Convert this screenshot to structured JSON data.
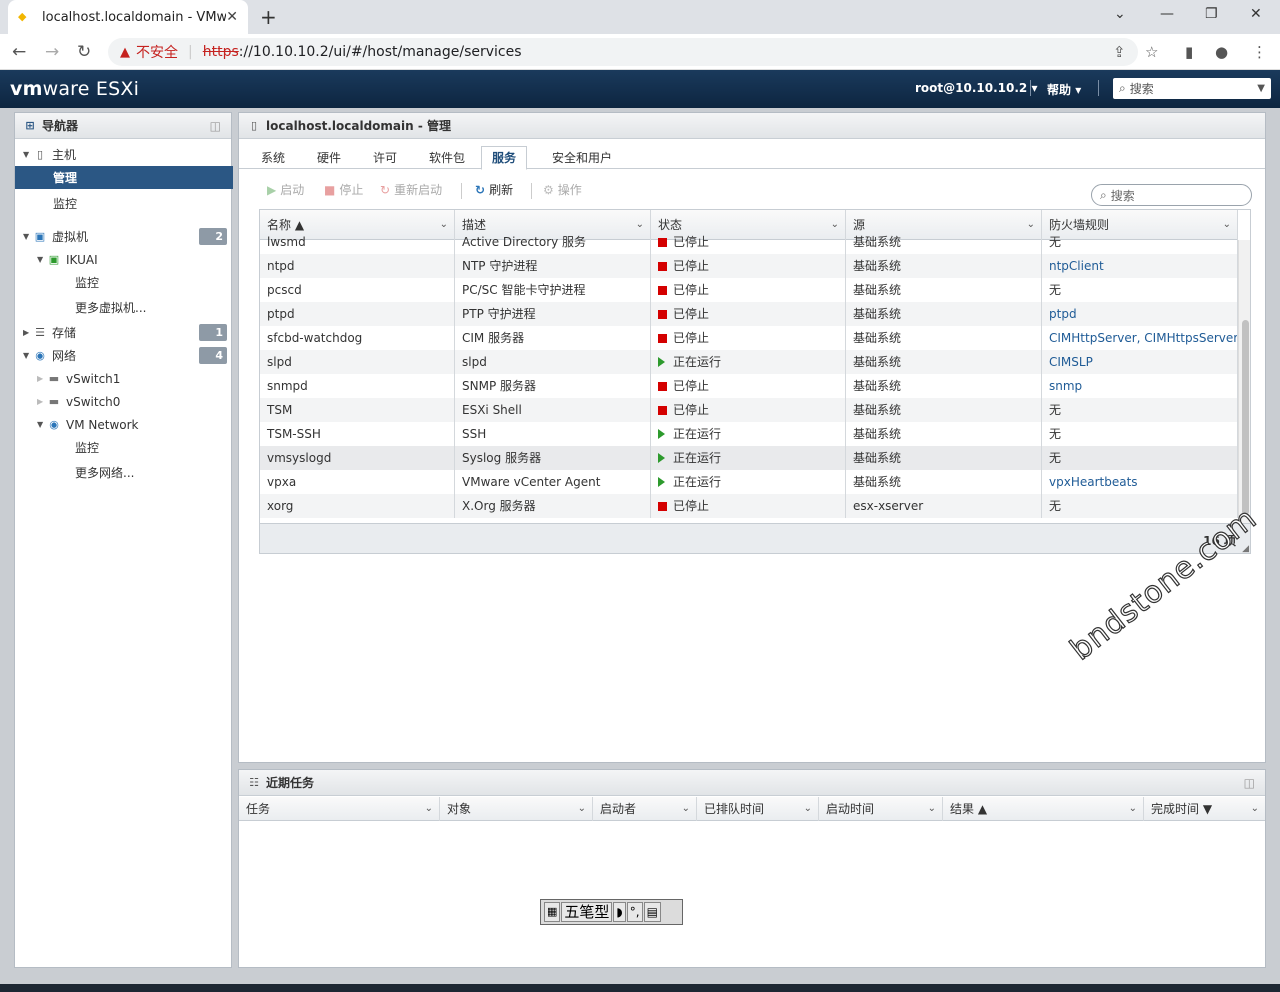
{
  "browser": {
    "tab_title": "localhost.localdomain - VMwa",
    "security_label": "不安全",
    "url_scheme": "https",
    "url_rest": "://10.10.10.2/ui/#/host/manage/services"
  },
  "header": {
    "logo_vm": "vm",
    "logo_ware": "ware",
    "logo_product": "ESXi",
    "user": "root@10.10.10.2",
    "help": "帮助",
    "search_placeholder": "搜索"
  },
  "navigator": {
    "title": "导航器",
    "host": "主机",
    "manage": "管理",
    "monitor": "监控",
    "vms": "虚拟机",
    "vms_count": "2",
    "vm_name": "IKUAI",
    "vm_monitor": "监控",
    "more_vms": "更多虚拟机...",
    "storage": "存储",
    "storage_count": "1",
    "network": "网络",
    "network_count": "4",
    "vswitch1": "vSwitch1",
    "vswitch0": "vSwitch0",
    "vm_network": "VM Network",
    "net_monitor": "监控",
    "more_networks": "更多网络..."
  },
  "main": {
    "title": "localhost.localdomain - 管理",
    "tabs": [
      "系统",
      "硬件",
      "许可",
      "软件包",
      "服务",
      "安全和用户"
    ],
    "toolbar": {
      "start": "启动",
      "stop": "停止",
      "restart": "重新启动",
      "refresh": "刷新",
      "actions": "操作",
      "search_placeholder": "搜索"
    },
    "columns": [
      "名称 ▲",
      "描述",
      "状态",
      "源",
      "防火墙规则"
    ],
    "rows": [
      {
        "name": "lwsmd",
        "desc": "Active Directory 服务",
        "status": "已停止",
        "running": false,
        "source": "基础系统",
        "rules": "无",
        "link": false
      },
      {
        "name": "ntpd",
        "desc": "NTP 守护进程",
        "status": "已停止",
        "running": false,
        "source": "基础系统",
        "rules": "ntpClient",
        "link": true
      },
      {
        "name": "pcscd",
        "desc": "PC/SC 智能卡守护进程",
        "status": "已停止",
        "running": false,
        "source": "基础系统",
        "rules": "无",
        "link": false
      },
      {
        "name": "ptpd",
        "desc": "PTP 守护进程",
        "status": "已停止",
        "running": false,
        "source": "基础系统",
        "rules": "ptpd",
        "link": true
      },
      {
        "name": "sfcbd-watchdog",
        "desc": "CIM 服务器",
        "status": "已停止",
        "running": false,
        "source": "基础系统",
        "rules": "CIMHttpServer, CIMHttpsServer",
        "link": true
      },
      {
        "name": "slpd",
        "desc": "slpd",
        "status": "正在运行",
        "running": true,
        "source": "基础系统",
        "rules": "CIMSLP",
        "link": true
      },
      {
        "name": "snmpd",
        "desc": "SNMP 服务器",
        "status": "已停止",
        "running": false,
        "source": "基础系统",
        "rules": "snmp",
        "link": true
      },
      {
        "name": "TSM",
        "desc": "ESXi Shell",
        "status": "已停止",
        "running": false,
        "source": "基础系统",
        "rules": "无",
        "link": false
      },
      {
        "name": "TSM-SSH",
        "desc": "SSH",
        "status": "正在运行",
        "running": true,
        "source": "基础系统",
        "rules": "无",
        "link": false
      },
      {
        "name": "vmsyslogd",
        "desc": "Syslog 服务器",
        "status": "正在运行",
        "running": true,
        "source": "基础系统",
        "rules": "无",
        "link": false
      },
      {
        "name": "vpxa",
        "desc": "VMware vCenter Agent",
        "status": "正在运行",
        "running": true,
        "source": "基础系统",
        "rules": "vpxHeartbeats",
        "link": true
      },
      {
        "name": "xorg",
        "desc": "X.Org 服务器",
        "status": "已停止",
        "running": false,
        "source": "esx-xserver",
        "rules": "无",
        "link": false
      }
    ],
    "count": "16 项"
  },
  "tasks": {
    "title": "近期任务",
    "columns": [
      "任务",
      "对象",
      "启动者",
      "已排队时间",
      "启动时间",
      "结果 ▲",
      "完成时间 ▼"
    ]
  },
  "watermark": "bndstone.com",
  "ime": {
    "mode": "五笔型"
  }
}
